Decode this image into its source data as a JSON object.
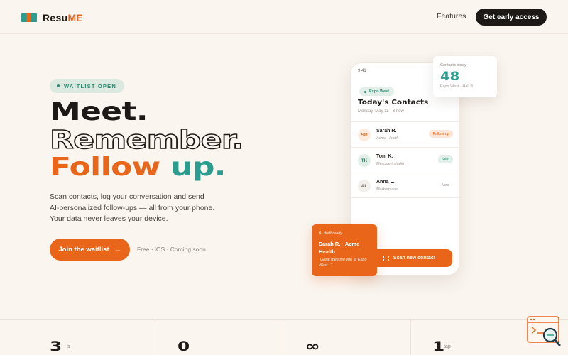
{
  "header": {
    "brand_prefix": "Resu",
    "brand_suffix": "ME",
    "nav_features": "Features",
    "cta_label": "Get early access"
  },
  "hero": {
    "badge": "WAITLIST OPEN",
    "line1": "Meet.",
    "line2": "Remember.",
    "line3_a": "Follow",
    "line3_b": " up.",
    "sub1": "Scan contacts, log your conversation and send",
    "sub2": "AI-personalized follow-ups — all from your phone.",
    "sub3": "Your data never leaves your device.",
    "join_label": "Join the waitlist",
    "free_note": "Free · iOS · Coming soon"
  },
  "phone": {
    "time": "9:41",
    "event": "Expo West",
    "title": "Today's Contacts",
    "date": "Monday, May 11 · 3 new",
    "contacts": [
      {
        "initials": "SR",
        "name": "Sarah R.",
        "company": "Acme Health",
        "status": "Follow up"
      },
      {
        "initials": "TK",
        "name": "Tom K.",
        "company": "Merchant studio",
        "status": "Sent"
      },
      {
        "initials": "AL",
        "name": "Anna L.",
        "company": "Marketplace",
        "status": "New"
      }
    ],
    "scan_label": "Scan new contact"
  },
  "stats_card": {
    "label": "Contacts today",
    "value": "48",
    "sub": "Expo West · Hall B"
  },
  "draft_card": {
    "label": "AI draft ready",
    "name": "Sarah R. · Acme Health",
    "quote": "\"Great meeting you at Expo West...\""
  },
  "bottom_stats": [
    {
      "value": "3",
      "unit": "s"
    },
    {
      "value": "0",
      "unit": ""
    },
    {
      "value": "∞",
      "unit": ""
    },
    {
      "value": "1",
      "unit": "tap"
    }
  ],
  "colors": {
    "accent_orange": "#e8651a",
    "accent_teal": "#2a9d8f",
    "dark": "#1c1916",
    "background": "#faf5ef"
  }
}
